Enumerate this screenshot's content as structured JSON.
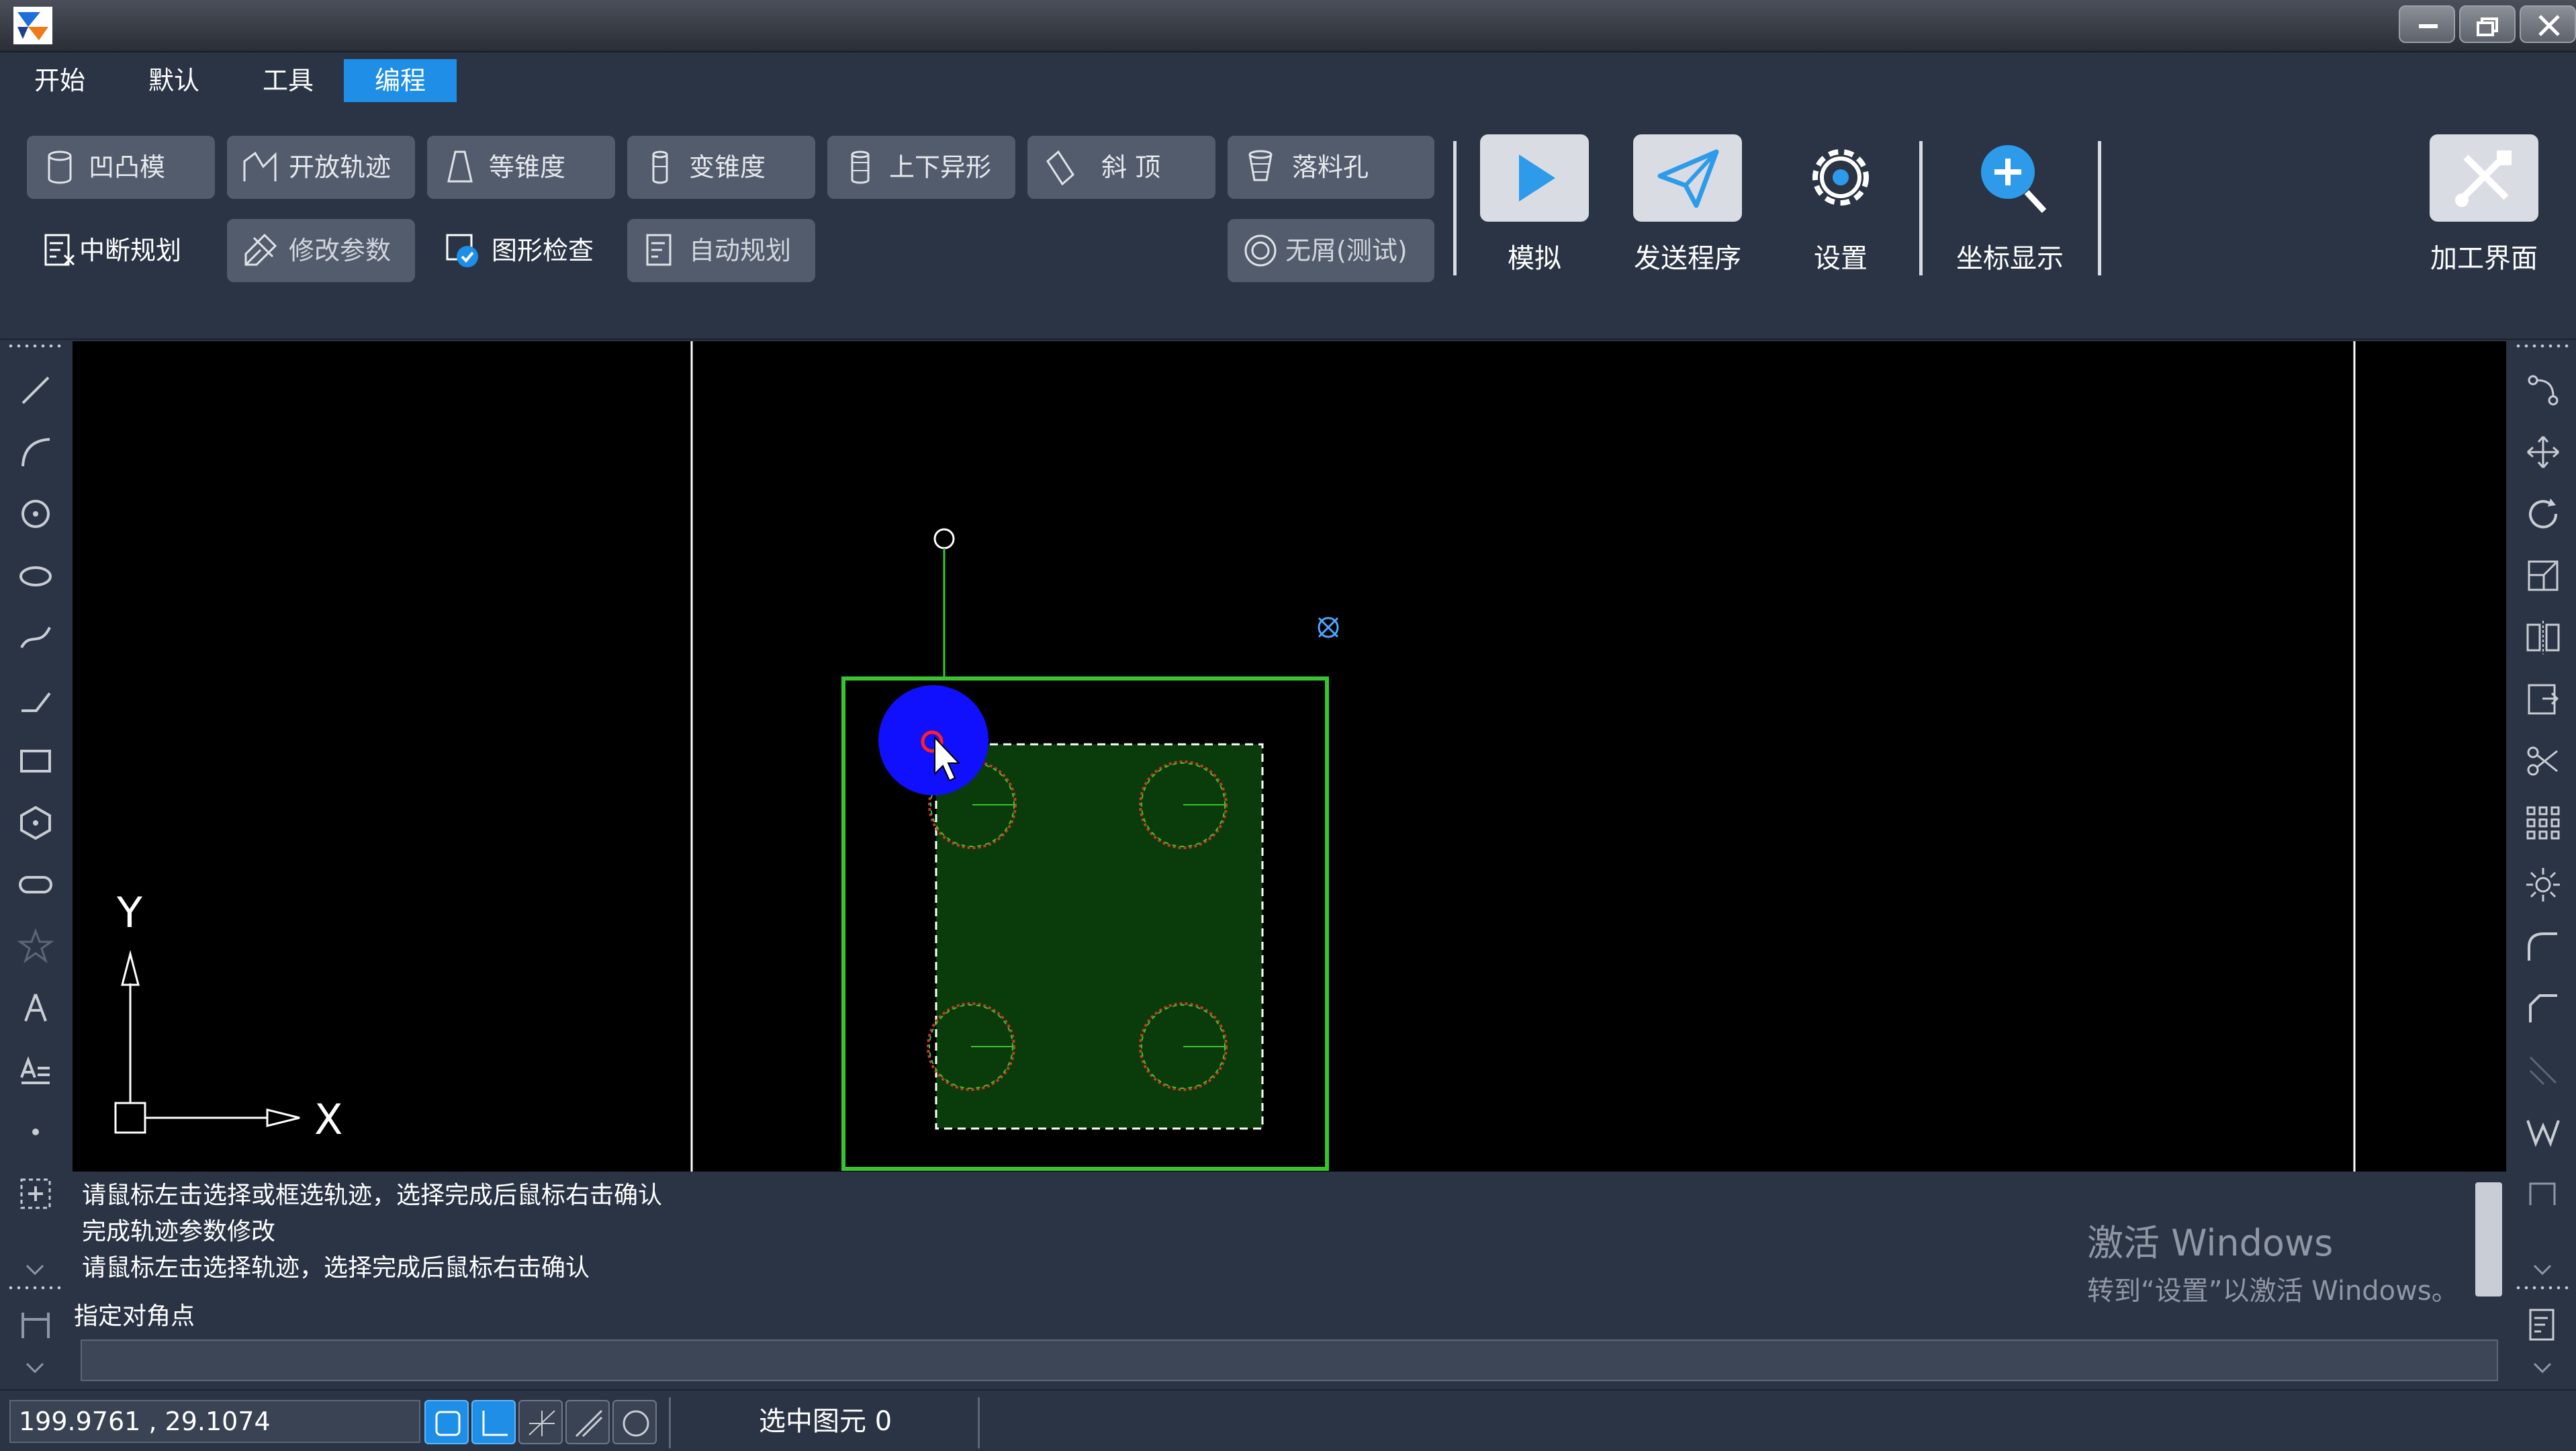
{
  "menu": {
    "tabs": [
      "开始",
      "默认",
      "工具",
      "编程"
    ],
    "active_index": 3
  },
  "ribbon": {
    "row1": [
      "凹凸模",
      "开放轨迹",
      "等锥度",
      "变锥度",
      "上下异形",
      "斜 顶",
      "落料孔"
    ],
    "row2": {
      "interrupt": "中断规划",
      "modify": "修改参数",
      "check": "图形检查",
      "auto": "自动规划",
      "no_chip": "无屑(测试)"
    },
    "large": {
      "simulate": "模拟",
      "send": "发送程序",
      "settings": "设置",
      "coords": "坐标显示",
      "machining": "加工界面"
    }
  },
  "canvas": {
    "axis_y": "Y",
    "axis_x": "X"
  },
  "command": {
    "lines": [
      "请鼠标左击选择或框选轨迹，选择完成后鼠标右击确认",
      "完成轨迹参数修改",
      "请鼠标左击选择轨迹，选择完成后鼠标右击确认"
    ],
    "prompt": "指定对角点",
    "input_value": ""
  },
  "watermark": {
    "line1": "激活 Windows",
    "line2": "转到“设置”以激活 Windows。"
  },
  "status": {
    "coordinates": "199.9761 , 29.1074",
    "selected": "选中图元 0"
  },
  "colors": {
    "accent": "#1e8ee6",
    "background": "#2b3445",
    "outline": "#39c42f",
    "highlight": "#1010ff"
  }
}
